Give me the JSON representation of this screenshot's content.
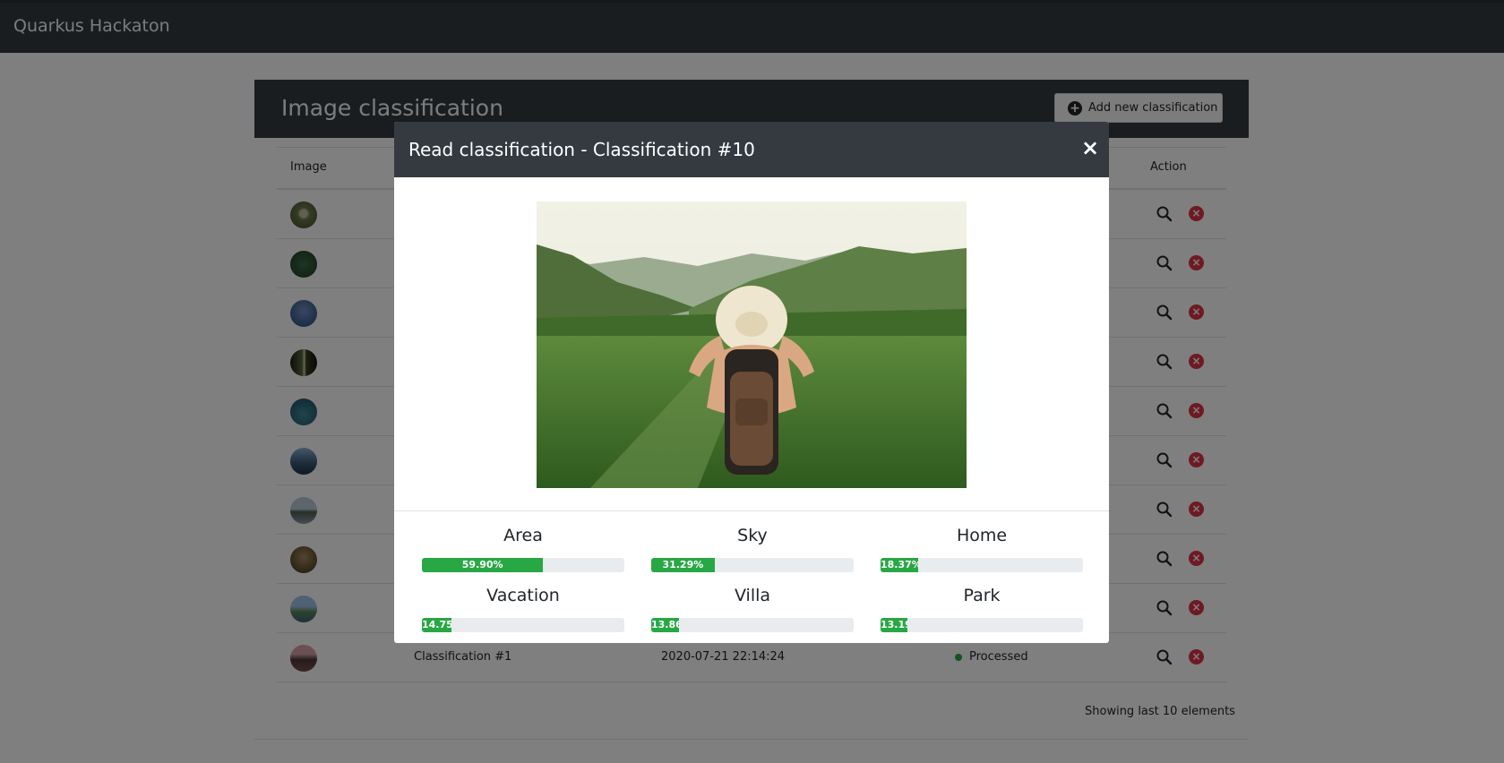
{
  "app": {
    "brand": "Quarkus Hackaton"
  },
  "page": {
    "title": "Image classification",
    "add_button_label": "Add new classification",
    "columns": {
      "image": "Image",
      "action": "Action"
    },
    "footer": "Showing last 10 elements"
  },
  "rows": [
    {
      "name": "",
      "date": "",
      "status": ""
    },
    {
      "name": "",
      "date": "",
      "status": ""
    },
    {
      "name": "",
      "date": "",
      "status": ""
    },
    {
      "name": "",
      "date": "",
      "status": ""
    },
    {
      "name": "",
      "date": "",
      "status": ""
    },
    {
      "name": "",
      "date": "",
      "status": ""
    },
    {
      "name": "",
      "date": "",
      "status": ""
    },
    {
      "name": "",
      "date": "",
      "status": ""
    },
    {
      "name": "",
      "date": "",
      "status": ""
    },
    {
      "name": "Classification #1",
      "date": "2020-07-21 22:14:24",
      "status": "Processed"
    }
  ],
  "modal": {
    "title": "Read classification - Classification #10",
    "close_symbol": "×",
    "metrics": [
      {
        "label": "Area",
        "value": 59.9,
        "text": "59.90%"
      },
      {
        "label": "Sky",
        "value": 31.29,
        "text": "31.29%"
      },
      {
        "label": "Home",
        "value": 18.37,
        "text": "18.37%"
      },
      {
        "label": "Vacation",
        "value": 14.75,
        "text": "14.75"
      },
      {
        "label": "Villa",
        "value": 13.86,
        "text": "13.86"
      },
      {
        "label": "Park",
        "value": 13.19,
        "text": "13.19"
      }
    ]
  },
  "icons": {
    "add": "plus-circle-icon",
    "view": "search-icon",
    "delete": "close-circle-icon"
  },
  "colors": {
    "navbar": "#343a40",
    "success": "#28a745",
    "danger": "#dc3545"
  }
}
